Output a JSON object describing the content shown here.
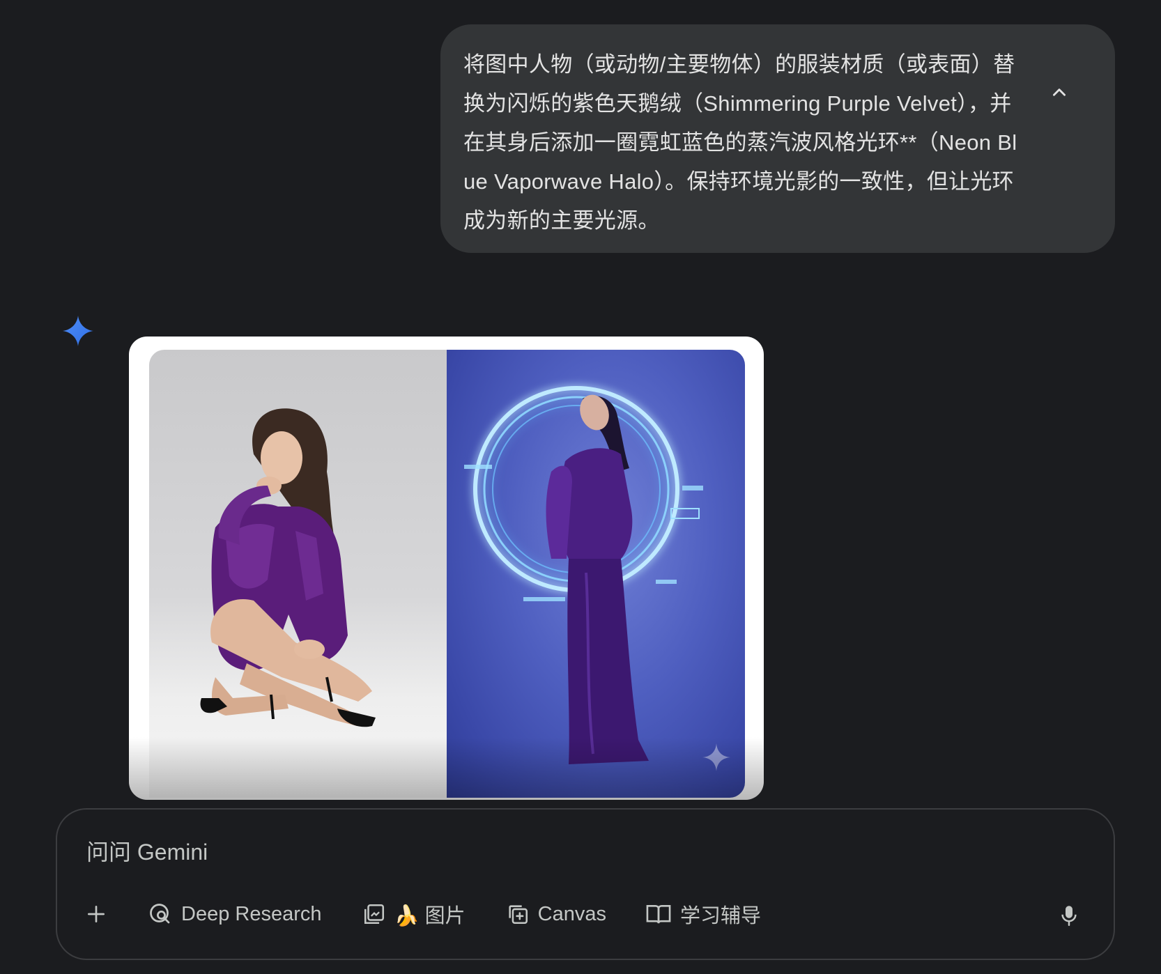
{
  "user_message": {
    "text": "将图中人物（或动物/主要物体）的服装材质（或表面）替换为闪烁的紫色天鹅绒（Shimmering Purple Velvet），并在其身后添加一圈霓虹蓝色的蒸汽波风格光环**（Neon Blue Vaporwave Halo）。保持环境光影的一致性，但让光环成为新的主要光源。",
    "collapse_icon": "chevron-up-icon"
  },
  "response": {
    "avatar_icon": "gemini-spark-icon",
    "image_panels": [
      "original-photo-seated-woman-purple-velvet",
      "edited-photo-standing-woman-neon-halo"
    ],
    "watermark_icon": "gemini-spark-watermark"
  },
  "input": {
    "placeholder": "问问 Gemini"
  },
  "toolbar": {
    "add_icon": "plus-icon",
    "deep_research_label": "Deep Research",
    "image_label": "🍌 图片",
    "canvas_label": "Canvas",
    "guided_learning_label": "学习辅导",
    "mic_icon": "microphone-icon"
  },
  "colors": {
    "background": "#1b1c1f",
    "bubble": "#333537",
    "text": "#e3e3e3",
    "muted_text": "#c4c7c5",
    "spark_blue": "#4285f4",
    "neon_halo": "#8fd8ff"
  }
}
